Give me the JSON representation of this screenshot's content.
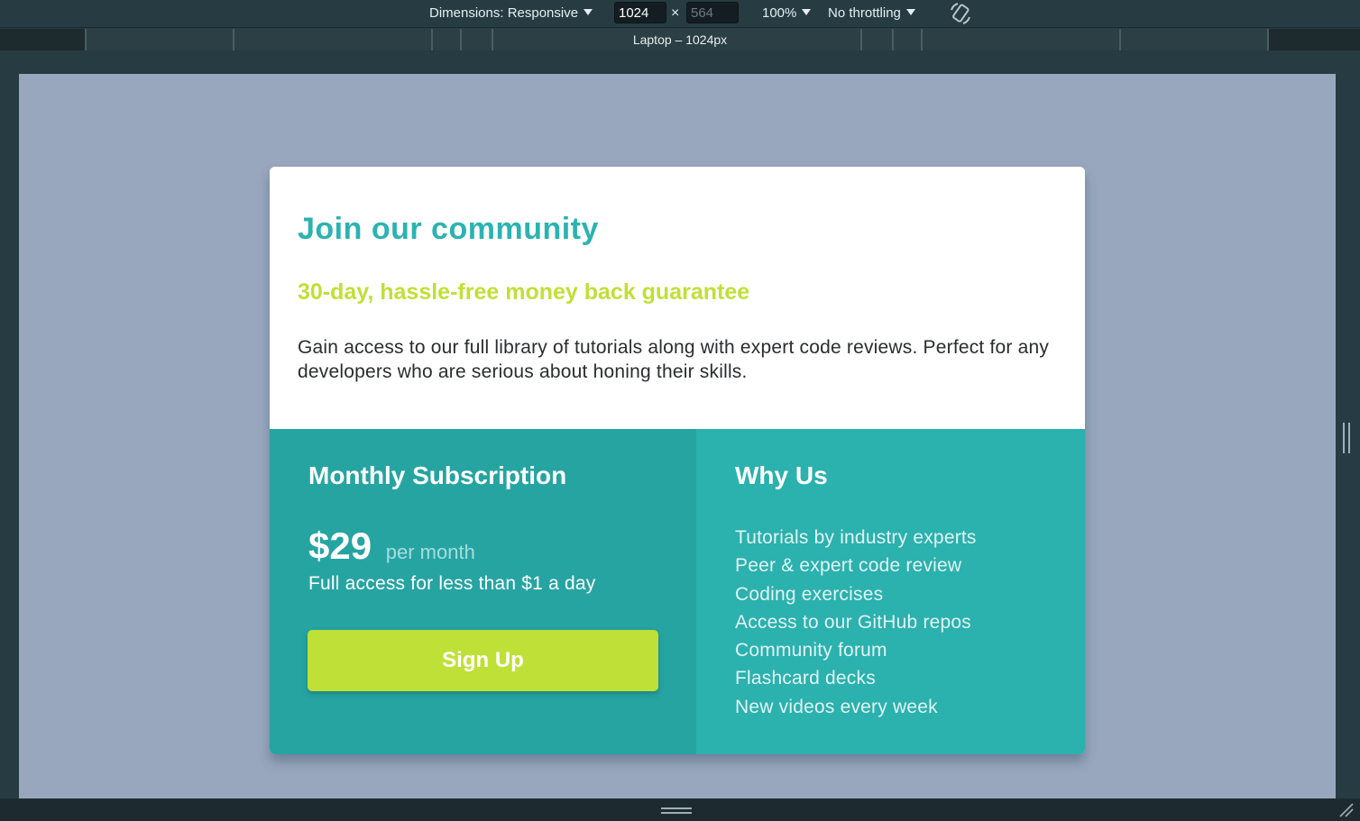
{
  "devtools": {
    "dimensions_label": "Dimensions: Responsive",
    "width_value": "1024",
    "height_value": "564",
    "times": "×",
    "zoom": "100%",
    "throttling": "No throttling",
    "breakpoint_label": "Laptop – 1024px"
  },
  "card": {
    "title": "Join our community",
    "subtitle": "30-day, hassle-free money back guarantee",
    "description": "Gain access to our full library of tutorials along with expert code reviews. Perfect for any developers who are serious about honing their skills.",
    "colors": {
      "accent": "#2bb3b1",
      "lime": "#bfe037",
      "left_panel": "#26a4a2",
      "right_panel": "#2bb1ae"
    }
  },
  "subscription": {
    "title": "Monthly Subscription",
    "price": "$29",
    "per": "per month",
    "note": "Full access for less than $1 a day",
    "button": "Sign Up"
  },
  "why": {
    "title": "Why Us",
    "items": [
      "Tutorials by industry experts",
      "Peer & expert code review",
      "Coding exercises",
      "Access to our GitHub repos",
      "Community forum",
      "Flashcard decks",
      "New videos every week"
    ]
  }
}
